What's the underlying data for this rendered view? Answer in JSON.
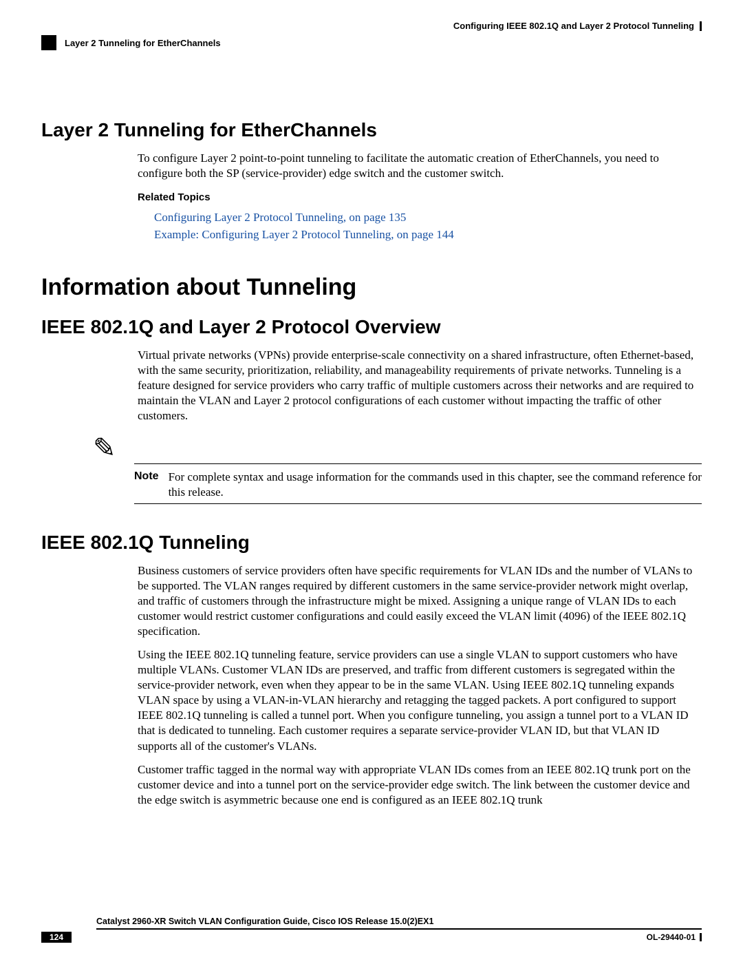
{
  "header": {
    "chapter_title": "Configuring IEEE 802.1Q and Layer 2 Protocol Tunneling",
    "section_header": "Layer 2 Tunneling for EtherChannels"
  },
  "sec1": {
    "heading": "Layer 2 Tunneling for EtherChannels",
    "para": "To configure Layer 2 point-to-point tunneling to facilitate the automatic creation of EtherChannels, you need to configure both the SP (service-provider) edge switch and the customer switch.",
    "related_label": "Related Topics",
    "link1": "Configuring Layer 2 Protocol Tunneling,  on page 135",
    "link2": "Example: Configuring Layer 2 Protocol Tunneling,  on page 144"
  },
  "sec2": {
    "heading": "Information about Tunneling"
  },
  "sec3": {
    "heading": "IEEE 802.1Q and Layer 2 Protocol Overview",
    "para": "Virtual private networks (VPNs) provide enterprise-scale connectivity on a shared infrastructure, often Ethernet-based, with the same security, prioritization, reliability, and manageability requirements of private networks. Tunneling is a feature designed for service providers who carry traffic of multiple customers across their networks and are required to maintain the VLAN and Layer 2 protocol configurations of each customer without impacting the traffic of other customers.",
    "note_label": "Note",
    "note_text": "For complete syntax and usage information for the commands used in this chapter, see the command reference for this release."
  },
  "sec4": {
    "heading": "IEEE 802.1Q Tunneling",
    "para1": "Business customers of service providers often have specific requirements for VLAN IDs and the number of VLANs to be supported. The VLAN ranges required by different customers in the same service-provider network might overlap, and traffic of customers through the infrastructure might be mixed. Assigning a unique range of VLAN IDs to each customer would restrict customer configurations and could easily exceed the VLAN limit (4096) of the IEEE 802.1Q specification.",
    "para2": "Using the IEEE 802.1Q tunneling feature, service providers can use a single VLAN to support customers who have multiple VLANs. Customer VLAN IDs are preserved, and traffic from different customers is segregated within the service-provider network, even when they appear to be in the same VLAN. Using IEEE 802.1Q tunneling expands VLAN space by using a VLAN-in-VLAN hierarchy and retagging the tagged packets. A port configured to support IEEE 802.1Q tunneling is called a tunnel port. When you configure tunneling, you assign a tunnel port to a VLAN ID that is dedicated to tunneling. Each customer requires a separate service-provider VLAN ID, but that VLAN ID supports all of the customer's VLANs.",
    "para3": "Customer traffic tagged in the normal way with appropriate VLAN IDs comes from an IEEE 802.1Q trunk port on the customer device and into a tunnel port on the service-provider edge switch. The link between the customer device and the edge switch is asymmetric because one end is configured as an IEEE 802.1Q trunk"
  },
  "footer": {
    "guide": "Catalyst 2960-XR Switch VLAN Configuration Guide, Cisco IOS Release 15.0(2)EX1",
    "page": "124",
    "docid": "OL-29440-01"
  }
}
